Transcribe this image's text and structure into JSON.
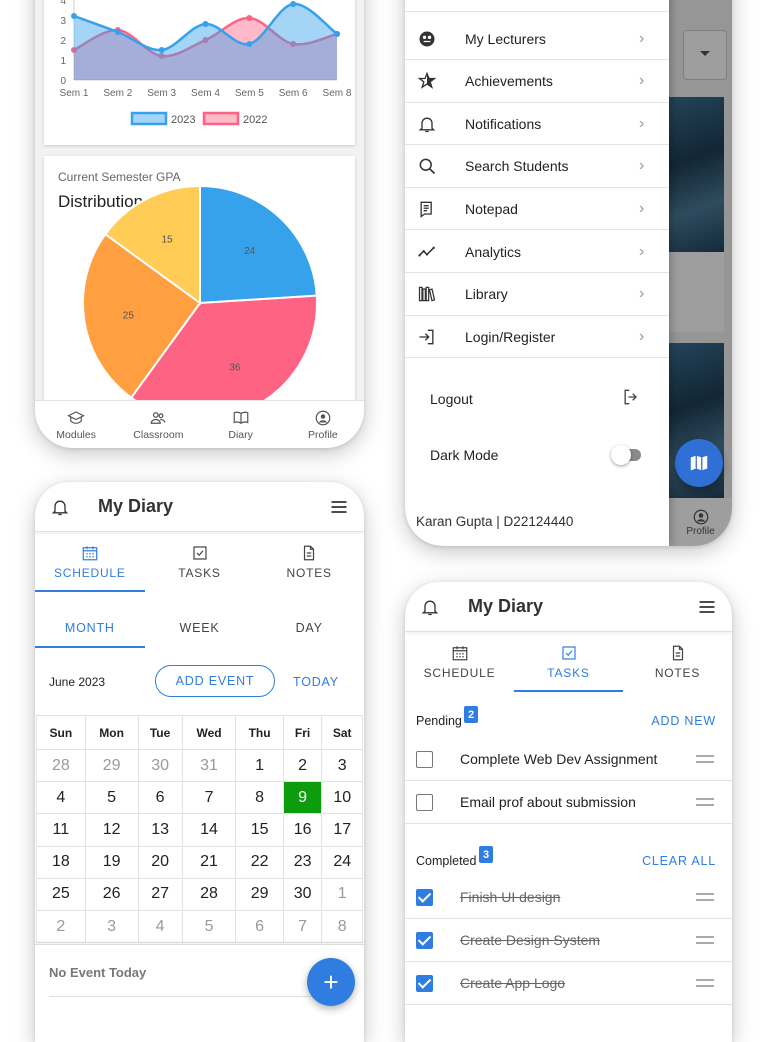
{
  "line_chart": {
    "chart_data": {
      "type": "area",
      "categories": [
        "Sem 1",
        "Sem 2",
        "Sem 3",
        "Sem 4",
        "Sem 5",
        "Sem 6",
        "Sem 8"
      ],
      "yticks": [
        "0",
        "1",
        "2",
        "3",
        "4"
      ],
      "ylim": [
        0,
        4
      ],
      "series": [
        {
          "name": "2023",
          "values": [
            3.2,
            2.4,
            1.5,
            2.8,
            1.8,
            3.8,
            2.3
          ],
          "color": "#36a2eb",
          "fill": "rgba(54,162,235,0.45)"
        },
        {
          "name": "2022",
          "values": [
            1.5,
            2.5,
            1.2,
            2.0,
            3.1,
            1.8,
            2.3
          ],
          "color": "#ff6384",
          "fill": "rgba(255,99,132,0.45)"
        }
      ],
      "legend": "bottom"
    }
  },
  "pie_card": {
    "subtitle": "Current Semester GPA",
    "title": "Distribution",
    "chart_data": {
      "type": "pie",
      "values": [
        24,
        36,
        25,
        15
      ],
      "labels": [
        "24",
        "36",
        "25",
        "15"
      ],
      "colors": [
        "#36a2eb",
        "#ff6384",
        "#ff9f40",
        "#ffcd56"
      ]
    }
  },
  "bottom_nav": {
    "items": [
      {
        "label": "Modules",
        "icon": "modules-icon"
      },
      {
        "label": "Classroom",
        "icon": "classroom-icon"
      },
      {
        "label": "Diary",
        "icon": "diary-icon"
      },
      {
        "label": "Profile",
        "icon": "profile-icon"
      }
    ],
    "partial_profile": "Profile"
  },
  "drawer": {
    "items": [
      {
        "label": "My Lecturers",
        "icon": "lecturers-icon"
      },
      {
        "label": "Achievements",
        "icon": "achievements-icon"
      },
      {
        "label": "Notifications",
        "icon": "bell-icon"
      },
      {
        "label": "Search Students",
        "icon": "search-icon"
      },
      {
        "label": "Notepad",
        "icon": "notepad-icon"
      },
      {
        "label": "Analytics",
        "icon": "analytics-icon"
      },
      {
        "label": "Library",
        "icon": "library-icon"
      },
      {
        "label": "Login/Register",
        "icon": "login-icon"
      }
    ],
    "logout": "Logout",
    "dark_mode": "Dark Mode",
    "dark_mode_on": false,
    "footer": "Karan Gupta | D22124440"
  },
  "diary": {
    "title": "My Diary",
    "tabs": [
      "SCHEDULE",
      "TASKS",
      "NOTES"
    ]
  },
  "schedule": {
    "subtabs": [
      "MONTH",
      "WEEK",
      "DAY"
    ],
    "month_label": "June 2023",
    "add_event": "ADD EVENT",
    "today": "TODAY",
    "weekdays": [
      "Sun",
      "Mon",
      "Tue",
      "Wed",
      "Thu",
      "Fri",
      "Sat"
    ],
    "weeks": [
      [
        "28",
        "29",
        "30",
        "31",
        "1",
        "2",
        "3"
      ],
      [
        "4",
        "5",
        "6",
        "7",
        "8",
        "9",
        "10"
      ],
      [
        "11",
        "12",
        "13",
        "14",
        "15",
        "16",
        "17"
      ],
      [
        "18",
        "19",
        "20",
        "21",
        "22",
        "23",
        "24"
      ],
      [
        "25",
        "26",
        "27",
        "28",
        "29",
        "30",
        "1"
      ],
      [
        "2",
        "3",
        "4",
        "5",
        "6",
        "7",
        "8"
      ]
    ],
    "selected_day": "9",
    "no_event": "No Event Today",
    "fab": "+"
  },
  "tasks": {
    "pending_label": "Pending",
    "pending_count": "2",
    "add_new": "ADD NEW",
    "pending": [
      {
        "text": "Complete Web Dev Assignment",
        "checked": false
      },
      {
        "text": "Email prof about submission",
        "checked": false
      }
    ],
    "completed_label": "Completed",
    "completed_count": "3",
    "clear_all": "CLEAR ALL",
    "completed": [
      {
        "text": "Finish UI design",
        "checked": true
      },
      {
        "text": "Create Design System",
        "checked": true
      },
      {
        "text": "Create App Logo",
        "checked": true
      }
    ]
  }
}
